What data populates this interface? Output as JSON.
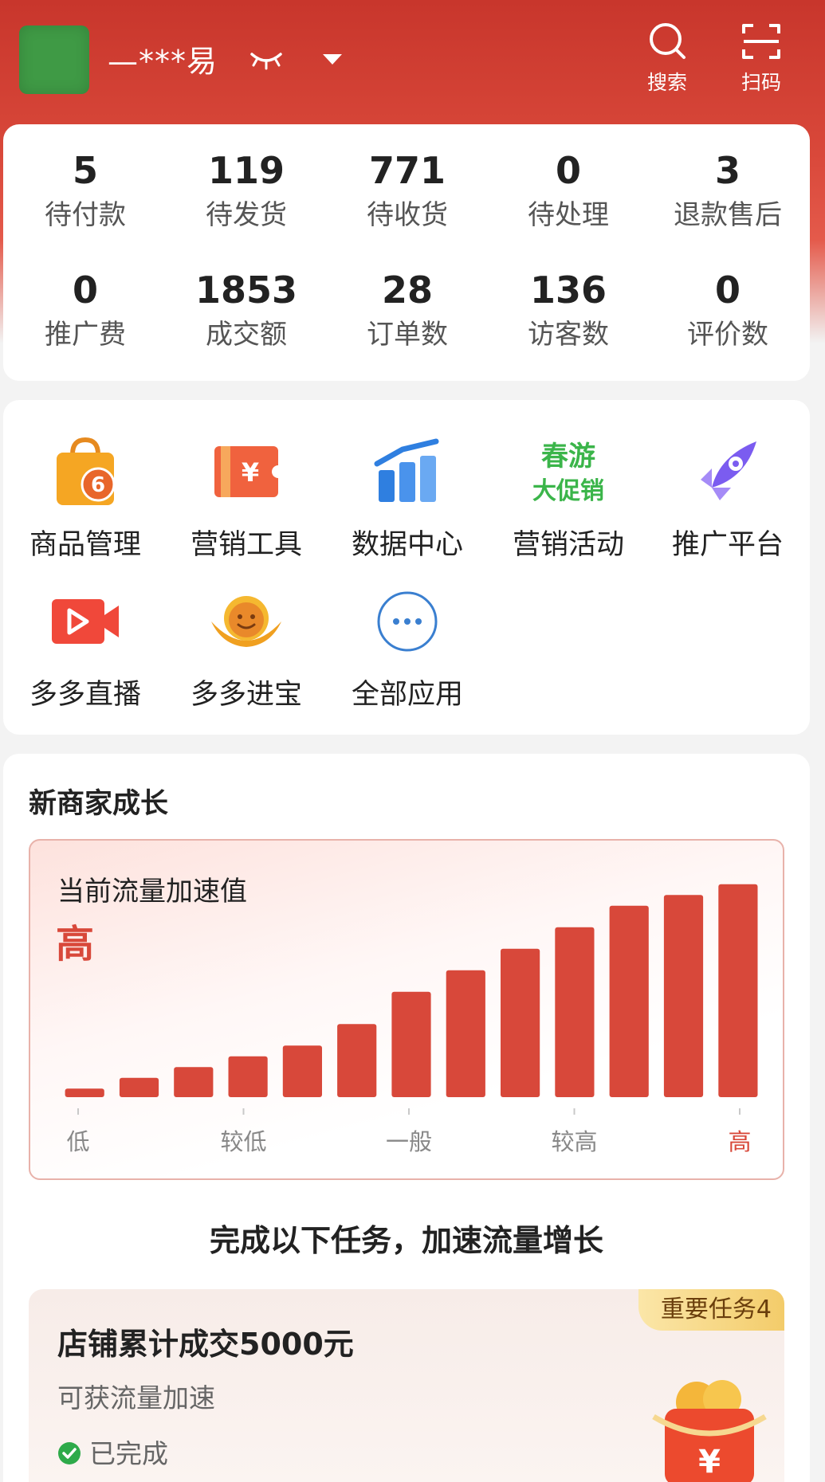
{
  "header": {
    "shop_name": "—***易",
    "search_label": "搜索",
    "scan_label": "扫码"
  },
  "stats": [
    {
      "value": "5",
      "label": "待付款"
    },
    {
      "value": "119",
      "label": "待发货"
    },
    {
      "value": "771",
      "label": "待收货"
    },
    {
      "value": "0",
      "label": "待处理"
    },
    {
      "value": "3",
      "label": "退款售后"
    },
    {
      "value": "0",
      "label": "推广费"
    },
    {
      "value": "1853",
      "label": "成交额"
    },
    {
      "value": "28",
      "label": "订单数"
    },
    {
      "value": "136",
      "label": "访客数"
    },
    {
      "value": "0",
      "label": "评价数"
    }
  ],
  "apps": [
    {
      "label": "商品管理",
      "icon": "shopping-bag-icon",
      "badge": "6"
    },
    {
      "label": "营销工具",
      "icon": "coupon-icon",
      "glyph": "¥"
    },
    {
      "label": "数据中心",
      "icon": "bar-chart-icon"
    },
    {
      "label": "营销活动",
      "icon": "spring-promo-icon",
      "text_line1": "春游",
      "text_line2": "大促销"
    },
    {
      "label": "推广平台",
      "icon": "rocket-icon"
    },
    {
      "label": "多多直播",
      "icon": "video-play-icon"
    },
    {
      "label": "多多进宝",
      "icon": "gold-ingot-icon"
    },
    {
      "label": "全部应用",
      "icon": "more-dots-icon"
    }
  ],
  "growth": {
    "title": "新商家成长",
    "chart_caption": "当前流量加速值",
    "current_level": "高",
    "task_heading": "完成以下任务，加速流量增长"
  },
  "chart_data": {
    "type": "bar",
    "categories": [
      "1",
      "2",
      "3",
      "4",
      "5",
      "6",
      "7",
      "8",
      "9",
      "10",
      "11",
      "12",
      "13"
    ],
    "values": [
      4,
      9,
      14,
      19,
      24,
      34,
      49,
      59,
      69,
      79,
      89,
      94,
      99
    ],
    "ylim": [
      0,
      100
    ],
    "tick_labels": [
      "低",
      "较低",
      "一般",
      "较高",
      "高"
    ],
    "highlight_tick": "高",
    "bar_color": "#d8483a"
  },
  "task": {
    "badge": "重要任务4",
    "title": "店铺累计成交5000元",
    "subtitle": "可获流量加速",
    "status": "已完成"
  },
  "colors": {
    "brand_red": "#d8483a",
    "header_red": "#c8362c",
    "success_green": "#2eaa4a"
  }
}
